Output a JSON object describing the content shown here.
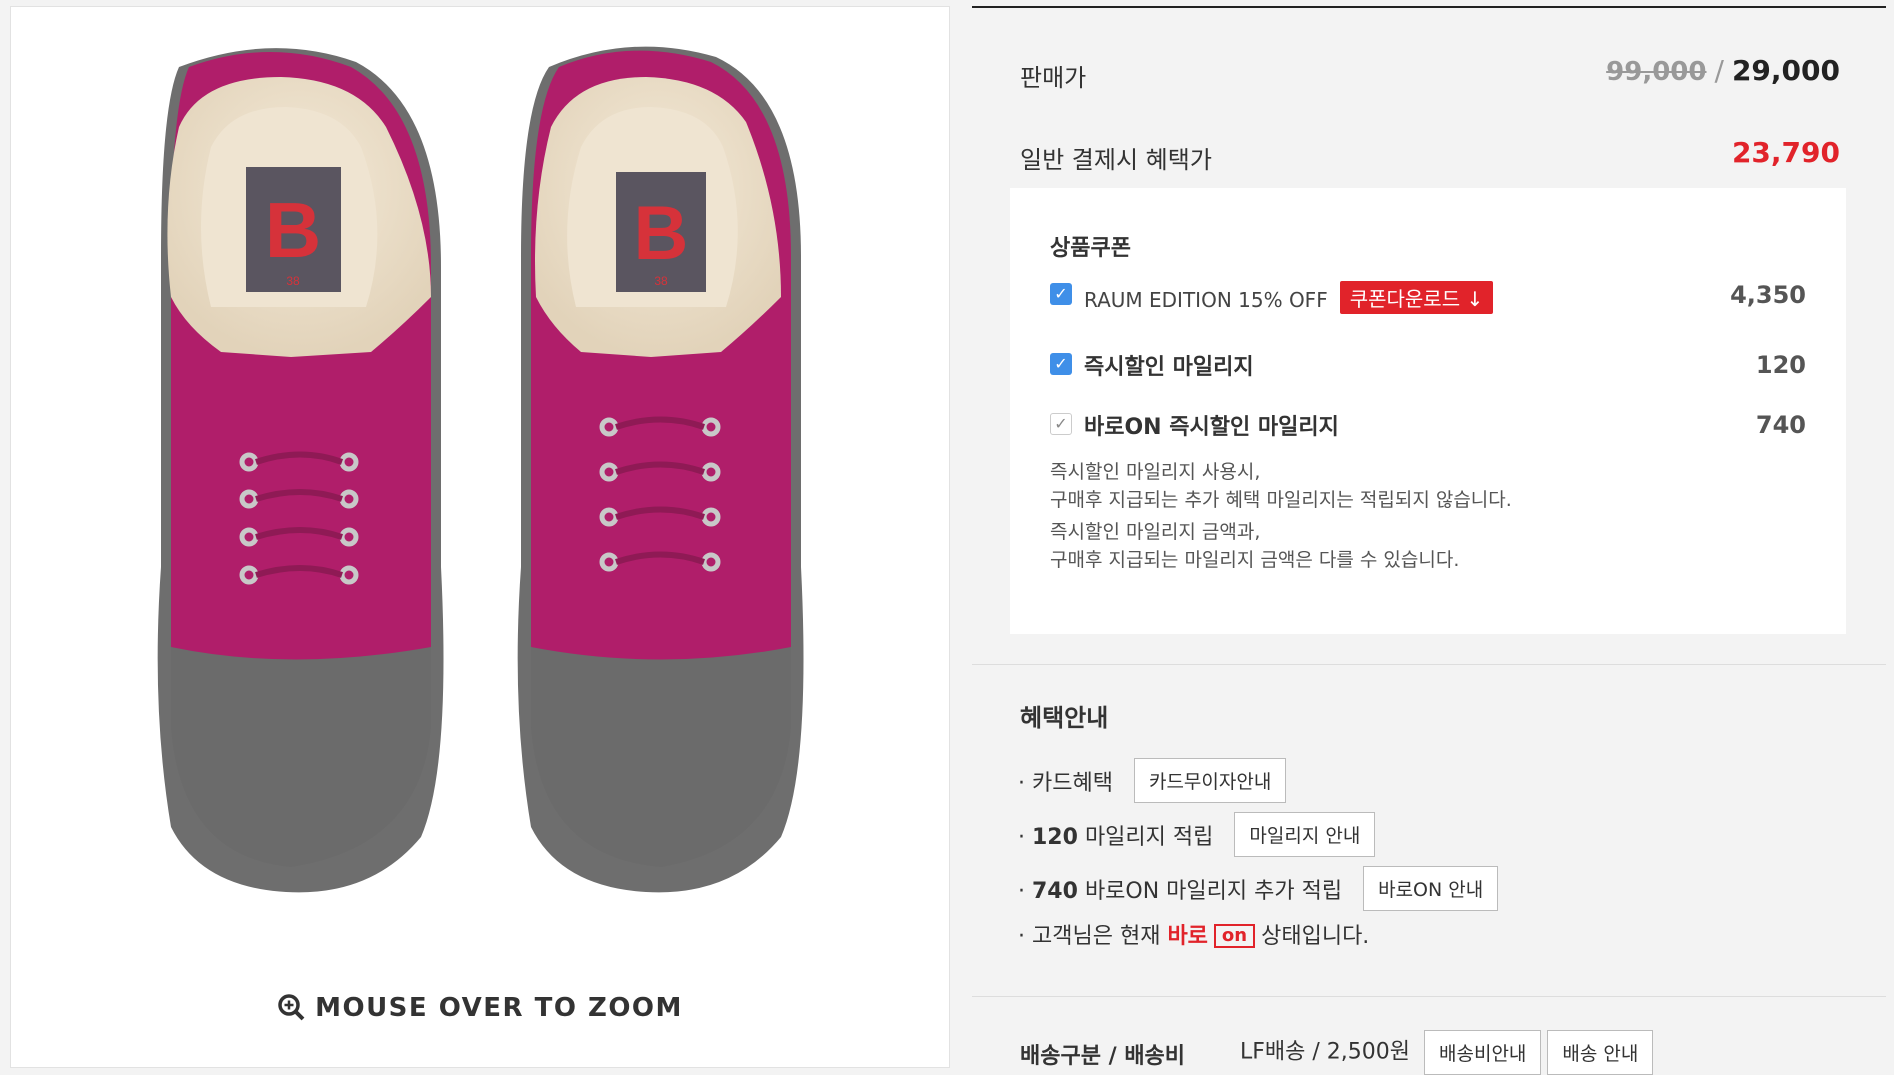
{
  "product_image": {
    "zoom_hint": "MOUSE OVER TO ZOOM",
    "brand_letter": "B",
    "size_tag": "38"
  },
  "price": {
    "label": "판매가",
    "original": "99,000",
    "separator": "/",
    "sale": "29,000"
  },
  "benefit_price": {
    "label": "일반 결제시 혜택가",
    "value": "23,790"
  },
  "coupon": {
    "title": "상품쿠폰",
    "items": [
      {
        "label": "RAUM EDITION 15% OFF",
        "button": "쿠폰다운로드 ↓",
        "amount": "4,350"
      },
      {
        "label": "즉시할인 마일리지",
        "amount": "120"
      },
      {
        "label": "바로ON 즉시할인 마일리지",
        "amount": "740"
      }
    ],
    "notes": [
      "즉시할인 마일리지 사용시,",
      "구매후 지급되는 추가 혜택 마일리지는 적립되지 않습니다.",
      "즉시할인 마일리지 금액과,",
      "구매후 지급되는 마일리지 금액은 다를 수 있습니다."
    ]
  },
  "benefits": {
    "title": "혜택안내",
    "card_label": "카드혜택",
    "card_button": "카드무이자안내",
    "mileage_amount": "120",
    "mileage_text": "마일리지 적립",
    "mileage_button": "마일리지 안내",
    "baro_amount": "740",
    "baro_text": "바로ON 마일리지 추가 적립",
    "baro_button": "바로ON 안내",
    "status_prefix": "고객님은 현재",
    "status_baro": "바로",
    "status_on": "on",
    "status_suffix": "상태입니다."
  },
  "shipping": {
    "label": "배송구분 / 배송비",
    "value": "LF배송 / 2,500원",
    "fee_button": "배송비안내",
    "info_button": "배송 안내"
  },
  "colors": {
    "accent_red": "#e1232a",
    "checkbox_blue": "#3f8fe8",
    "shoe_magenta": "#b01e6a",
    "sole_gray": "#6b6b6b"
  }
}
